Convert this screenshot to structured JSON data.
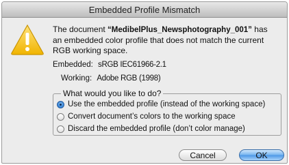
{
  "window": {
    "title": "Embedded Profile Mismatch"
  },
  "message": {
    "prefix": "The document ",
    "filename": "“MedibelPlus_Newsphotography_001”",
    "suffix": " has an embedded color profile that does not match the current RGB working space."
  },
  "embedded": {
    "label": "Embedded:",
    "value": "sRGB IEC61966-2.1"
  },
  "working": {
    "label": "Working:",
    "value": "Adobe RGB (1998)"
  },
  "group": {
    "legend": "What would you like to do?",
    "options": [
      {
        "label": "Use the embedded profile (instead of the working space)",
        "selected": true
      },
      {
        "label": "Convert document’s colors to the working space",
        "selected": false
      },
      {
        "label": "Discard the embedded profile (don’t color manage)",
        "selected": false
      }
    ]
  },
  "buttons": {
    "cancel": "Cancel",
    "ok": "OK"
  },
  "icon": "warning-icon",
  "colors": {
    "accent": "#4a96e6",
    "warning": "#f5c518"
  }
}
